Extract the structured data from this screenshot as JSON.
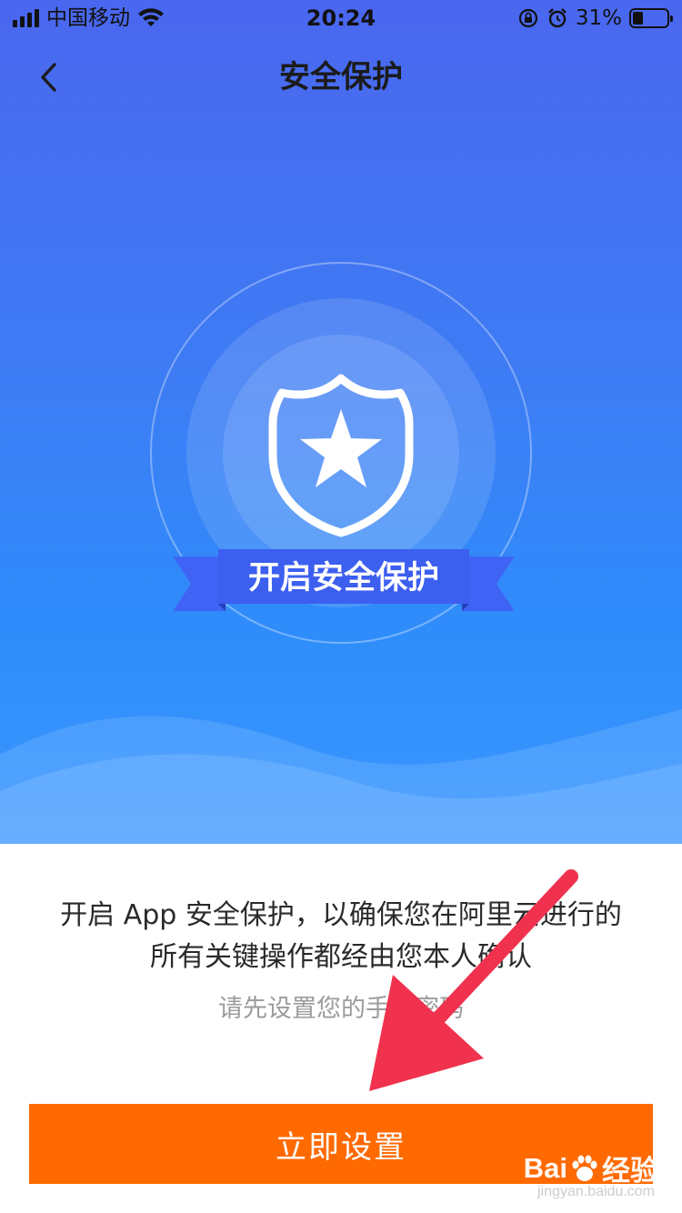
{
  "status_bar": {
    "carrier": "中国移动",
    "time": "20:24",
    "battery_percent": "31%",
    "battery_level": 0.31,
    "icons": [
      "signal-icon",
      "wifi-icon",
      "orientation-lock-icon",
      "alarm-icon",
      "battery-icon"
    ]
  },
  "nav": {
    "back_icon": "chevron-left-icon",
    "title": "安全保护"
  },
  "emblem": {
    "icon": "shield-star-icon",
    "ribbon_label": "开启安全保护"
  },
  "content": {
    "description_line1": "开启 App 安全保护，以确保您在阿里云进行的",
    "description_line2": "所有关键操作都经由您本人确认",
    "hint": "请先设置您的手势密码"
  },
  "cta": {
    "label": "立即设置"
  },
  "watermark": {
    "brand": "Bai",
    "brand2": "经验",
    "url": "jingyan.baidu.com"
  },
  "colors": {
    "hero_top": "#4a67ef",
    "hero_bottom": "#3a97ff",
    "ribbon": "#3d5ff0",
    "cta": "#ff6a00",
    "arrow": "#f0324e"
  }
}
